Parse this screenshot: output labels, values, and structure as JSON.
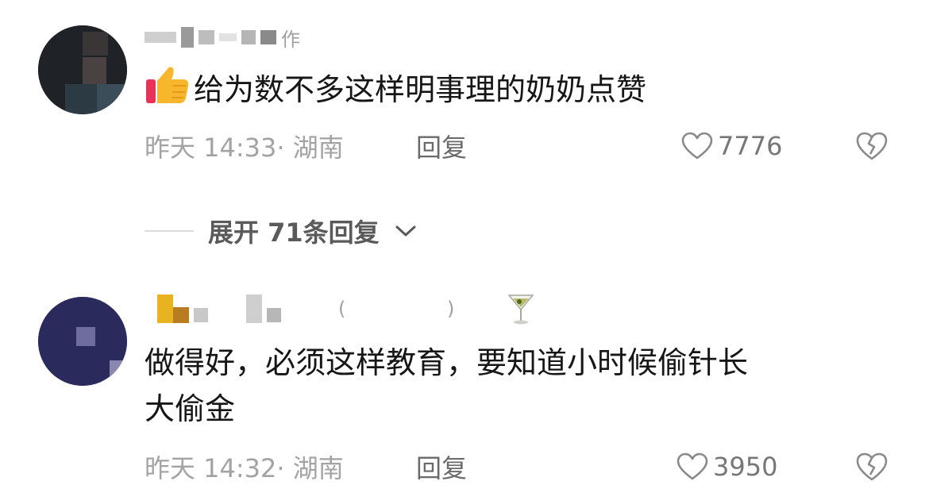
{
  "comments": [
    {
      "username_suffix": "作",
      "emoji": "thumbs-up-icon",
      "text": "给为数不多这样明事理的奶奶点赞",
      "time": "昨天 14:33",
      "location": "· 湖南",
      "reply_label": "回复",
      "like_count": "7776"
    },
    {
      "username_suffix": "( )",
      "emoji": "cocktail-glass-icon",
      "text": "做得好，必须这样教育，要知道小时候偷针长大偷金",
      "line1": "做得好，必须这样教育，要知道小时候偷针长",
      "line2": "大偷金",
      "time": "昨天 14:32",
      "location": "· 湖南",
      "reply_label": "回复",
      "like_count": "3950"
    }
  ],
  "expand": {
    "label": "展开 71条回复"
  },
  "colors": {
    "text": "#161616",
    "meta": "#a3a3a3",
    "divider": "#dcdcdc"
  }
}
